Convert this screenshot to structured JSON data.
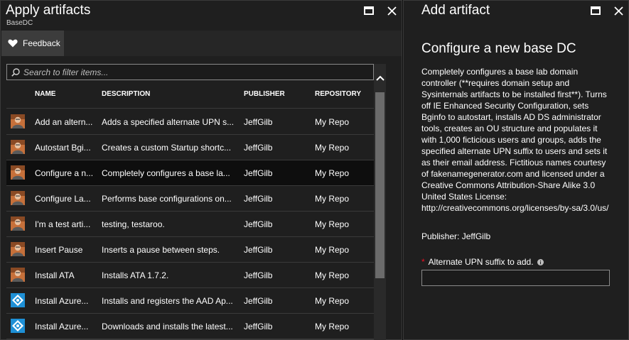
{
  "left_blade": {
    "title": "Apply artifacts",
    "subtitle": "BaseDC",
    "feedback_label": "Feedback",
    "search_placeholder": "Search to filter items...",
    "columns": {
      "name": "NAME",
      "description": "DESCRIPTION",
      "publisher": "PUBLISHER",
      "repository": "REPOSITORY"
    },
    "rows": [
      {
        "icon": "person-avatar-icon",
        "name": "Add an altern...",
        "description": "Adds a specified alternate UPN s...",
        "publisher": "JeffGilb",
        "repository": "My Repo",
        "selected": false
      },
      {
        "icon": "person-avatar-icon",
        "name": "Autostart Bgi...",
        "description": "Creates a custom Startup shortc...",
        "publisher": "JeffGilb",
        "repository": "My Repo",
        "selected": false
      },
      {
        "icon": "person-avatar-icon",
        "name": "Configure a n...",
        "description": "Completely configures a base la...",
        "publisher": "JeffGilb",
        "repository": "My Repo",
        "selected": true
      },
      {
        "icon": "person-avatar-icon",
        "name": "Configure La...",
        "description": "Performs base configurations on...",
        "publisher": "JeffGilb",
        "repository": "My Repo",
        "selected": false
      },
      {
        "icon": "person-avatar-icon",
        "name": "I'm a test arti...",
        "description": "testing, testaroo.",
        "publisher": "JeffGilb",
        "repository": "My Repo",
        "selected": false
      },
      {
        "icon": "person-avatar-icon",
        "name": "Insert Pause",
        "description": "Inserts a pause between steps.",
        "publisher": "JeffGilb",
        "repository": "My Repo",
        "selected": false
      },
      {
        "icon": "person-avatar-icon",
        "name": "Install ATA",
        "description": "Installs ATA 1.7.2.",
        "publisher": "JeffGilb",
        "repository": "My Repo",
        "selected": false
      },
      {
        "icon": "azure-ad-icon",
        "name": "Install Azure...",
        "description": "Installs and registers the AAD Ap...",
        "publisher": "JeffGilb",
        "repository": "My Repo",
        "selected": false
      },
      {
        "icon": "azure-ad-icon",
        "name": "Install Azure...",
        "description": "Downloads and installs the latest...",
        "publisher": "JeffGilb",
        "repository": "My Repo",
        "selected": false
      }
    ]
  },
  "right_blade": {
    "title": "Add artifact",
    "heading": "Configure a new base DC",
    "description": "Completely configures a base lab domain controller (**requires domain setup and Sysinternals artifacts to be installed first**). Turns off IE Enhanced Security Configuration, sets Bginfo to autostart, installs AD DS administrator tools, creates an OU structure and populates it with 1,000 ficticious users and groups, adds the specified alternate UPN suffix to users and sets it as their email address. Fictitious names courtesy of fakenamegenerator.com and licensed under a Creative Commons Attribution-Share Alike 3.0 United States License: http://creativecommons.org/licenses/by-sa/3.0/us/",
    "publisher": "Publisher: JeffGilb",
    "required_marker": "*",
    "param_label": "Alternate UPN suffix to add.",
    "param_value": ""
  },
  "colors": {
    "accent_blue": "#1e90d6",
    "required_red": "#e81123",
    "selected_row": "#0e0e0e",
    "blade_bg": "#1f1f1f"
  }
}
